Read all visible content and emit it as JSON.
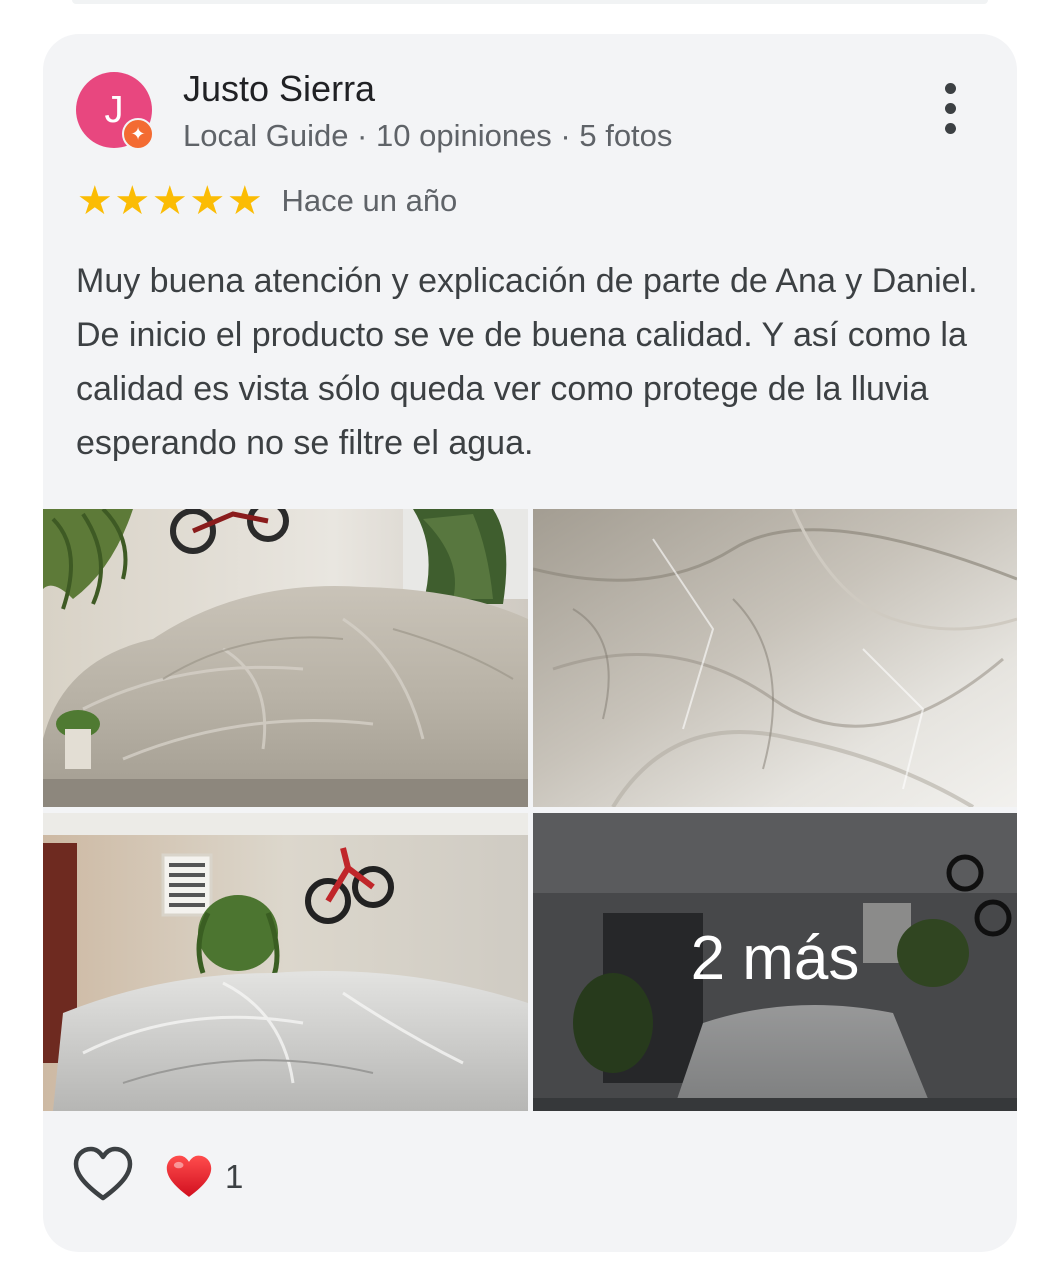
{
  "review": {
    "author": {
      "initial": "J",
      "name": "Justo Sierra",
      "meta": "Local Guide · 10 opiniones · 5 fotos",
      "avatar_color": "#e8477f",
      "badge_icon": "local-guide-star-icon",
      "badge_color": "#f36b32"
    },
    "rating": 5,
    "star_color": "#fbbc04",
    "time": "Hace un año",
    "text": "Muy buena atención y explicación de parte de Ana y Daniel. De inicio el producto se ve de buena calidad. Y así como la calidad es vista sólo queda ver como protege de la lluvia esperando no se filtre el agua.",
    "photos": {
      "items": [
        {
          "description_icon": "photo-car-cover-garage"
        },
        {
          "description_icon": "photo-car-cover-closeup"
        },
        {
          "description_icon": "photo-car-cover-bike-wall"
        },
        {
          "description_icon": "photo-car-cover-dark-garage"
        }
      ],
      "more_label": "2 más"
    },
    "actions": {
      "like_icon": "heart-outline-icon",
      "reaction_icon": "red-heart-icon",
      "reaction_count": "1"
    }
  }
}
